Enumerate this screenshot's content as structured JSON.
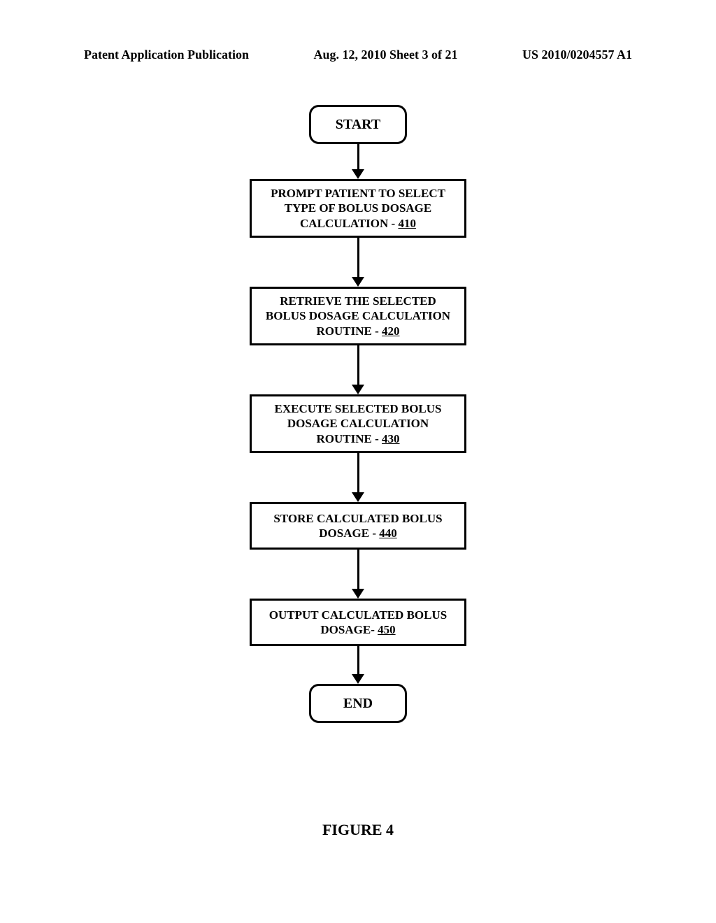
{
  "header": {
    "left": "Patent Application Publication",
    "center": "Aug. 12, 2010  Sheet 3 of 21",
    "right": "US 2010/0204557 A1"
  },
  "flow": {
    "start": "START",
    "end": "END",
    "steps": [
      {
        "text": "PROMPT PATIENT TO SELECT TYPE OF BOLUS DOSAGE CALCULATION",
        "sep": " - ",
        "ref": "410"
      },
      {
        "text": "RETRIEVE THE SELECTED BOLUS DOSAGE CALCULATION ROUTINE",
        "sep": " - ",
        "ref": "420"
      },
      {
        "text": "EXECUTE SELECTED BOLUS DOSAGE CALCULATION ROUTINE",
        "sep": " - ",
        "ref": "430"
      },
      {
        "text": "STORE CALCULATED BOLUS DOSAGE",
        "sep": " - ",
        "ref": "440"
      },
      {
        "text": "OUTPUT CALCULATED BOLUS DOSAGE",
        "sep": "- ",
        "ref": "450"
      }
    ]
  },
  "caption": "FIGURE 4"
}
